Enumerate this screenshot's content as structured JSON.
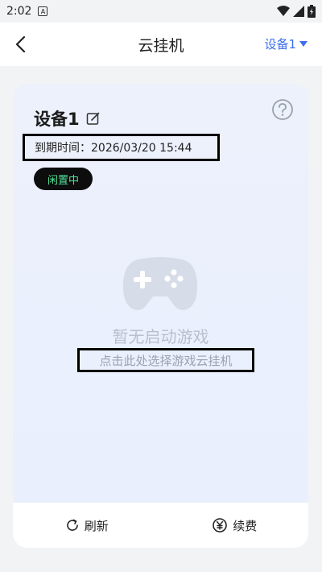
{
  "status_bar": {
    "time": "2:02",
    "app_icon": "A"
  },
  "header": {
    "title": "云挂机",
    "device_selector": "设备1",
    "back_icon": "chevron-left-icon"
  },
  "card": {
    "device_name": "设备1",
    "expiry_text": "到期时间：2026/03/20  15:44",
    "status_badge": "闲置中",
    "empty_title": "暂无启动游戏",
    "select_link": "点击此处选择游戏云挂机",
    "refresh_label": "刷新",
    "renew_label": "续费"
  },
  "colors": {
    "accent": "#3b6ff0",
    "badge_bg": "#0d0d0d",
    "badge_text": "#52e39a",
    "card_bg": "#e9effd",
    "muted_text": "#b9bfcc"
  }
}
